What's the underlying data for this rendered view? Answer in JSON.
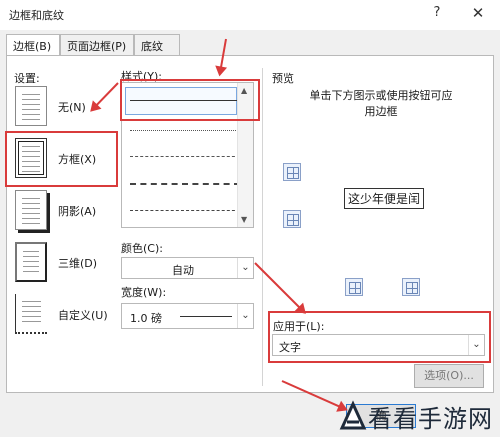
{
  "window": {
    "title": "边框和底纹",
    "help": "?",
    "close": "✕"
  },
  "tabs": [
    {
      "label": "边框(B)"
    },
    {
      "label": "页面边框(P)"
    },
    {
      "label": "底纹(S)"
    }
  ],
  "settings": {
    "heading": "设置:",
    "items": [
      {
        "label": "无(N)"
      },
      {
        "label": "方框(X)"
      },
      {
        "label": "阴影(A)"
      },
      {
        "label": "三维(D)"
      },
      {
        "label": "自定义(U)"
      }
    ]
  },
  "style": {
    "heading": "样式(Y):",
    "line_types": [
      "solid",
      "dotted",
      "dashed",
      "dashed",
      "dash-dot"
    ]
  },
  "color": {
    "heading": "颜色(C):",
    "value": "自动"
  },
  "width": {
    "heading": "宽度(W):",
    "value": "1.0 磅"
  },
  "preview": {
    "heading": "预览",
    "hint": "单击下方图示或使用按钮可应用边框",
    "sample_text": "这少年便是闰"
  },
  "apply_to": {
    "heading": "应用于(L):",
    "value": "文字"
  },
  "buttons": {
    "options": "选项(O)...",
    "ok": "确"
  },
  "watermark": {
    "text": "看看手游网"
  },
  "colors": {
    "highlight": "#d93b3b",
    "accent": "#6a86b6"
  }
}
